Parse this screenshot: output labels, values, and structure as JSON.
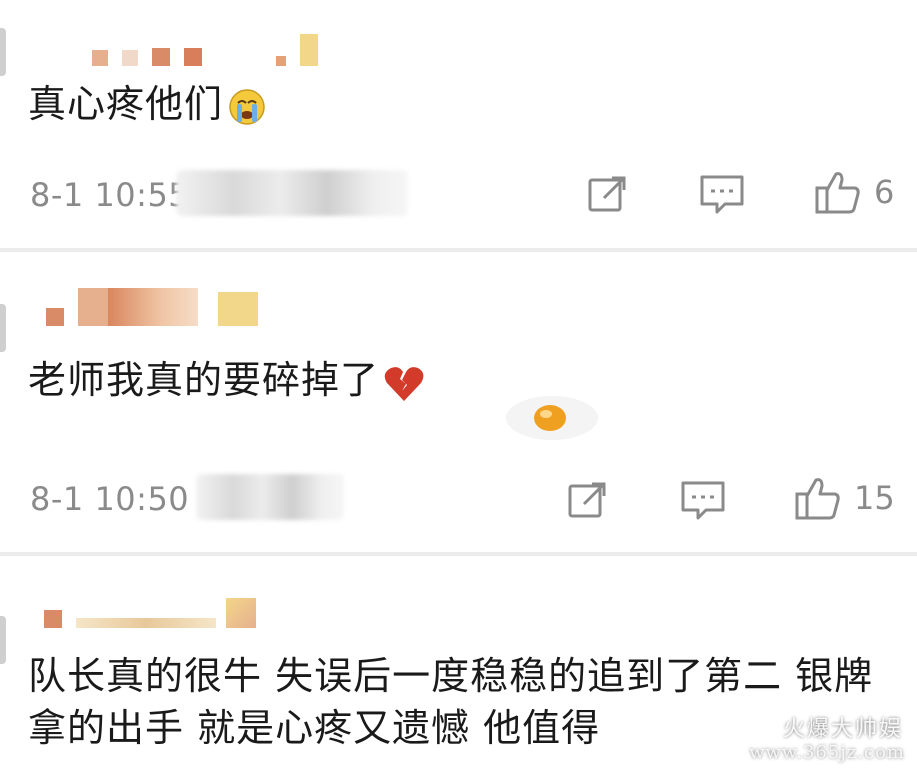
{
  "comments": [
    {
      "text": "真心疼他们",
      "emoji": "crying-face-icon",
      "timestamp": "8-1 10:55",
      "like_count": "6"
    },
    {
      "text": "老师我真的要碎掉了",
      "emoji": "broken-heart-icon",
      "sticker": "fried-egg-sticker",
      "timestamp": "8-1 10:50",
      "like_count": "15"
    },
    {
      "text": "队长真的很牛 失误后一度稳稳的追到了第二 银牌拿的出手 就是心疼又遗憾 他值得"
    }
  ],
  "watermark": {
    "text": "火爆大帅娱",
    "url": "www.365jz.com"
  },
  "colors": {
    "text": "#1a1a1a",
    "meta": "#8a8a8a",
    "separator": "#ececec",
    "mosaic_orange": "#e0a078",
    "mosaic_yellow": "#f0d070"
  }
}
